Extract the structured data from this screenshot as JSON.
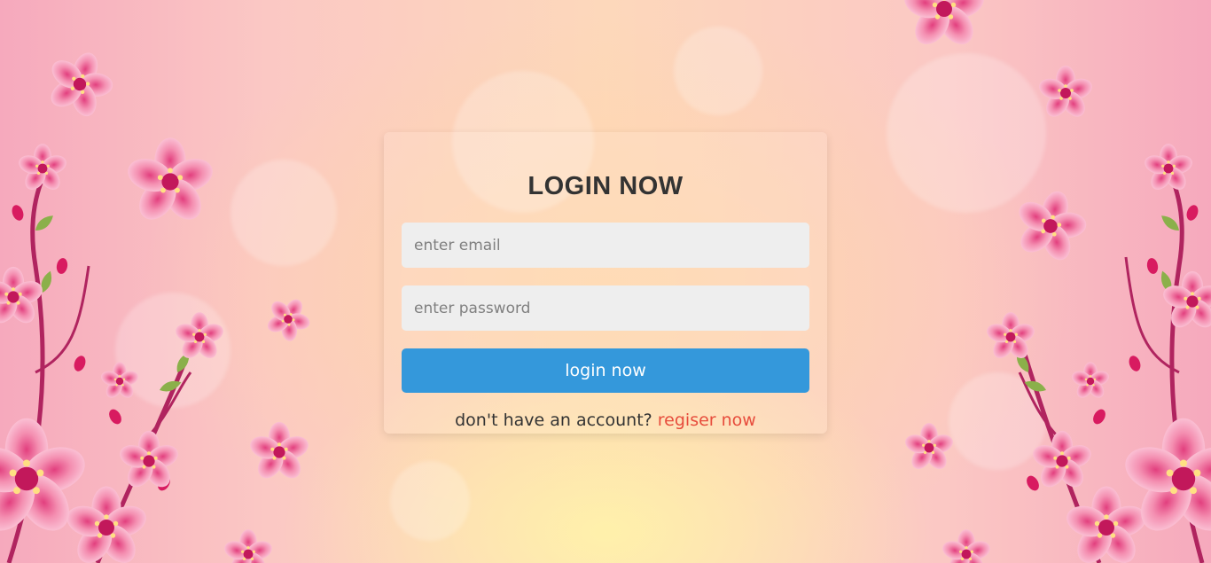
{
  "form": {
    "title": "LOGIN NOW",
    "email_placeholder": "enter email",
    "password_placeholder": "enter password",
    "submit_label": "login now",
    "register_prompt": "don't have an account?",
    "register_link": "regiser now"
  },
  "colors": {
    "primary_button": "#3498db",
    "link": "#e74c3c",
    "input_background": "#eeeeee",
    "title_text": "#333333",
    "blossom_pink": "#f48fb1"
  },
  "decoration": {
    "background_icon": "cherry-blossom-icon"
  }
}
